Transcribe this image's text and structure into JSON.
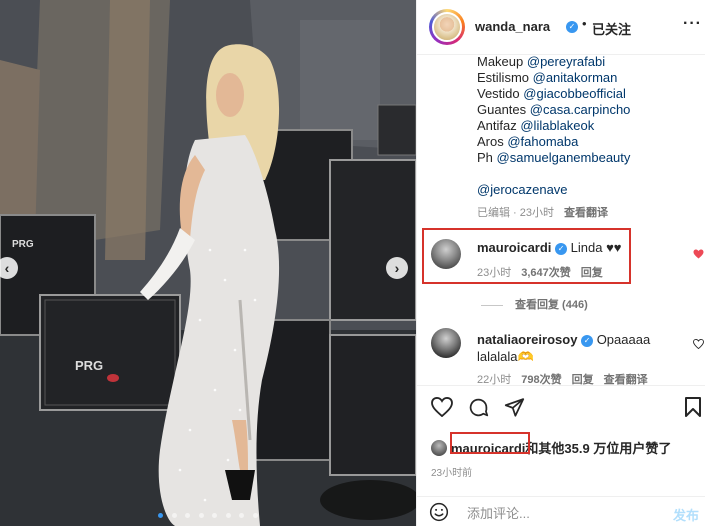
{
  "post": {
    "username": "wanda_nara",
    "header_dot": "•",
    "follow_label": "已关注",
    "more_label": "···"
  },
  "caption": {
    "lines": [
      {
        "prefix": "Makeup ",
        "tag": "@pereyrafabi"
      },
      {
        "prefix": "Estilismo ",
        "tag": "@anitakorman"
      },
      {
        "prefix": "Vestido ",
        "tag": "@giacobbeofficial"
      },
      {
        "prefix": "Guantes ",
        "tag": "@casa.carpincho"
      },
      {
        "prefix": "Antifaz ",
        "tag": "@lilablakeok"
      },
      {
        "prefix": "Aros ",
        "tag": "@fahomaba"
      },
      {
        "prefix": "Ph ",
        "tag": "@samuelganembeauty"
      }
    ],
    "extra_tag": "@jerocazenave",
    "meta": {
      "edited": "已编辑 · 23小时",
      "translate": "查看翻译"
    }
  },
  "comments": [
    {
      "username": "mauroicardi",
      "text": "Linda ♥♥",
      "time": "23小时",
      "likes": "3,647次赞",
      "reply": "回复",
      "view_replies": "查看回复 (446)"
    },
    {
      "username": "nataliaoreirosoy",
      "text_line1": "Opaaaaa",
      "text_line2": "lalalala🫶",
      "time": "22小时",
      "likes": "798次赞",
      "reply": "回复",
      "translate": "查看翻译"
    }
  ],
  "likes_summary": {
    "who": "mauroicardi",
    "rest": "和其他35.9 万位用户赞了",
    "time": "23小时前"
  },
  "add_comment": {
    "placeholder": "添加评论...",
    "post_label": "发布"
  },
  "carousel": {
    "prev": "‹",
    "next": "›",
    "dot_count": 8,
    "active_dot": 0
  },
  "colors": {
    "link": "#00376b",
    "verified": "#3897f0",
    "heart_liked": "#ed4956",
    "highlight": "#d6332b"
  },
  "icons": [
    "heart-icon",
    "comment-icon",
    "share-icon",
    "bookmark-icon",
    "emoji-icon",
    "verified-icon"
  ]
}
